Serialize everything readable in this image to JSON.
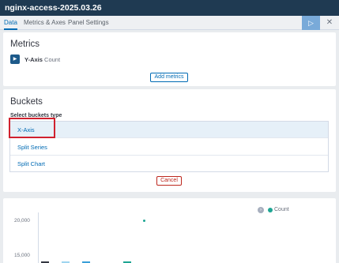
{
  "window": {
    "title": "nginx-access-2025.03.26"
  },
  "tabs": [
    {
      "label": "Data"
    },
    {
      "label": "Metrics & Axes"
    },
    {
      "label": "Panel Settings"
    }
  ],
  "toolbar": {
    "apply_icon": "play-icon",
    "apply_glyph": "▷",
    "close_icon": "close-icon",
    "close_glyph": "✕"
  },
  "metrics": {
    "title": "Metrics",
    "item": {
      "name": "Y-Axis",
      "value": "Count"
    },
    "add_label": "Add metrics"
  },
  "buckets": {
    "title": "Buckets",
    "select_label": "Select buckets type",
    "options": [
      {
        "label": "X-Axis"
      },
      {
        "label": "Split Series"
      },
      {
        "label": "Split Chart"
      }
    ],
    "cancel_label": "Cancel"
  },
  "chart": {
    "legend": {
      "label": "Count",
      "color": "#1ea593"
    },
    "y_ticks": [
      "20,000",
      "15,000"
    ]
  },
  "colors": {
    "accent": "#006bb4",
    "header": "#1f3a52",
    "danger": "#bd271e",
    "series": "#1ea593"
  }
}
